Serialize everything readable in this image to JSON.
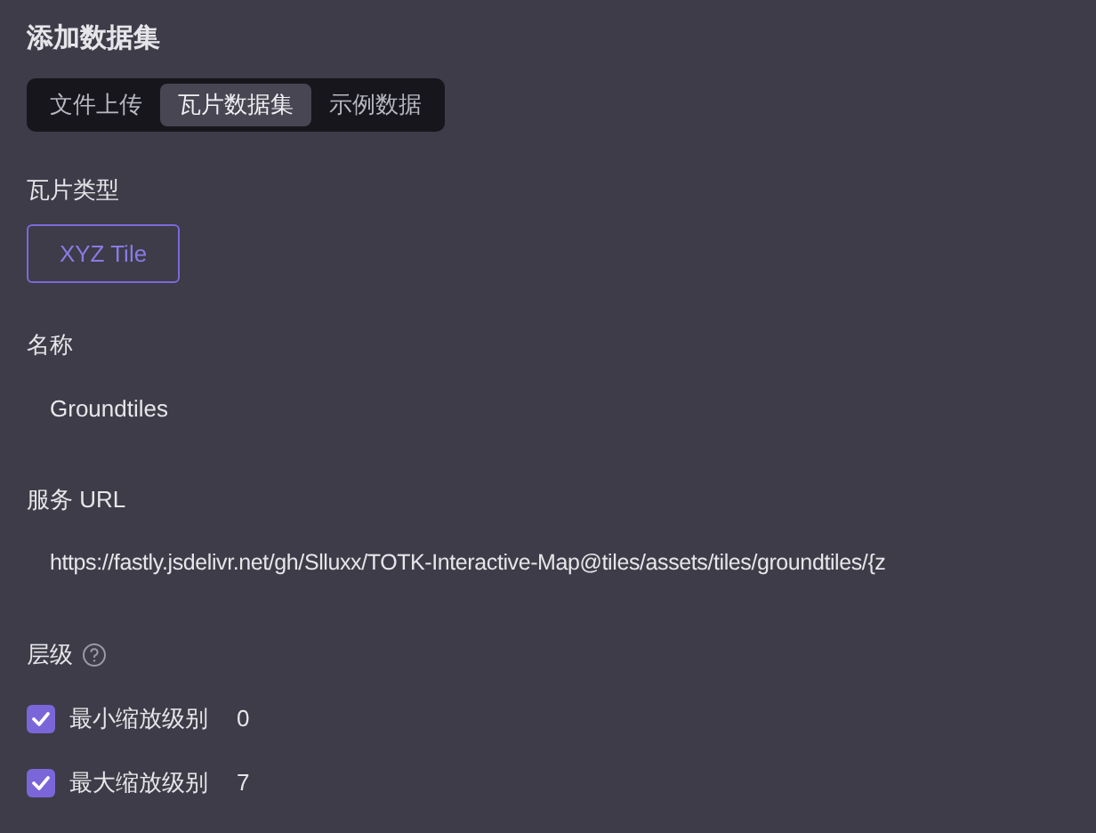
{
  "title": "添加数据集",
  "tabs": [
    {
      "label": "文件上传",
      "selected": false
    },
    {
      "label": "瓦片数据集",
      "selected": true
    },
    {
      "label": "示例数据",
      "selected": false
    }
  ],
  "tile_type": {
    "label": "瓦片类型",
    "options": [
      {
        "label": "XYZ Tile",
        "selected": true
      }
    ]
  },
  "name": {
    "label": "名称",
    "value": "Groundtiles"
  },
  "service_url": {
    "label": "服务 URL",
    "value": "https://fastly.jsdelivr.net/gh/Slluxx/TOTK-Interactive-Map@tiles/assets/tiles/groundtiles/{z"
  },
  "levels": {
    "label": "层级",
    "items": [
      {
        "label": "最小缩放级别",
        "checked": true,
        "value": "0"
      },
      {
        "label": "最大缩放级别",
        "checked": true,
        "value": "7"
      }
    ]
  }
}
